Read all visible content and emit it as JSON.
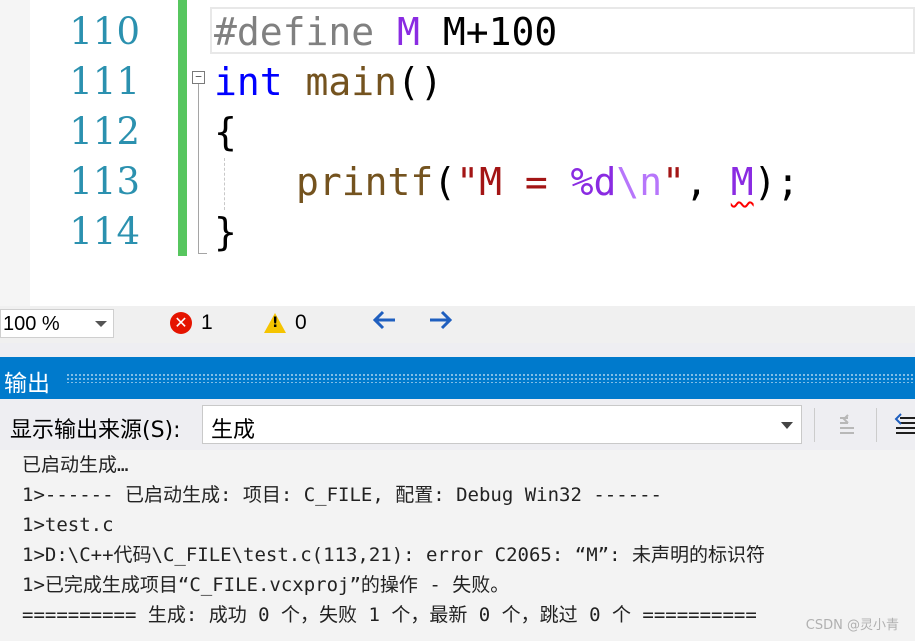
{
  "editor": {
    "line_numbers": [
      "110",
      "111",
      "112",
      "113",
      "114"
    ],
    "line110": {
      "directive": "#define",
      "macro": "M",
      "body": "M+100"
    },
    "line111": {
      "keyword": "int",
      "func": "main",
      "parens": "()"
    },
    "line112": {
      "brace": "{"
    },
    "line113": {
      "func": "printf",
      "open": "(",
      "quote_open": "\"",
      "str_text": "M = ",
      "fmt": "%d",
      "escape": "\\n",
      "quote_close": "\"",
      "comma": ", ",
      "arg": "M",
      "close": ");"
    },
    "line114": {
      "brace": "}"
    },
    "fold_symbol": "−"
  },
  "status": {
    "zoom": "100 %",
    "error_count": "1",
    "warning_count": "0",
    "error_icon": "✕",
    "warning_icon": "!",
    "nav_back_icon": "🡐",
    "nav_forward_icon": "🡒"
  },
  "output": {
    "title": "输出",
    "source_label": "显示输出来源(S):",
    "source_value": "生成",
    "lines": [
      "已启动生成…",
      "1>------ 已启动生成: 项目: C_FILE, 配置: Debug Win32 ------",
      "1>test.c",
      "1>D:\\C++代码\\C_FILE\\test.c(113,21): error C2065: “M”: 未声明的标识符",
      "1>已完成生成项目“C_FILE.vcxproj”的操作 - 失败。",
      "========== 生成: 成功 0 个，失败 1 个，最新 0 个，跳过 0 个 =========="
    ]
  },
  "watermark": "CSDN @灵小青",
  "colors": {
    "line_number": "#2b91af",
    "keyword": "#0000ff",
    "macro": "#8a2be2",
    "string": "#a31515",
    "function": "#74531f",
    "panel_header": "#007acc",
    "change_bar": "#57c65f"
  }
}
